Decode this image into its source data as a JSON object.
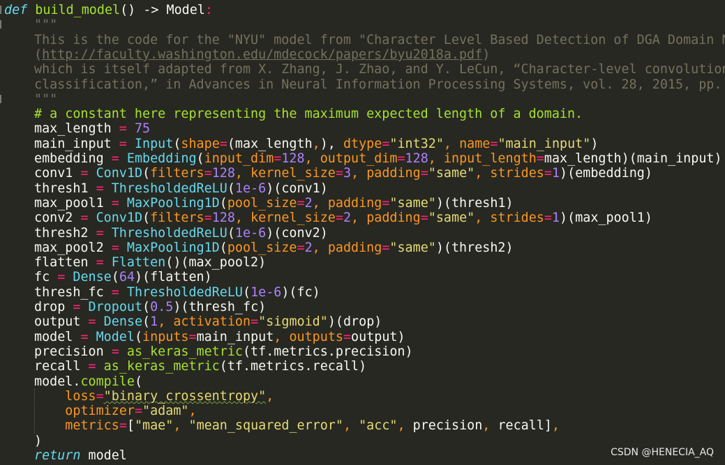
{
  "lines": [
    [
      [
        "kw",
        "def"
      ],
      [
        "plain",
        " "
      ],
      [
        "fn",
        "build_model"
      ],
      [
        "plain",
        "() -> Model"
      ],
      [
        "col",
        ":"
      ]
    ],
    [
      [
        "doc",
        "\"\"\""
      ]
    ],
    [
      [
        "doc",
        "This is the code for the \"NYU\" model from \"Character Level Based Detection of DGA Domain N"
      ]
    ],
    [
      [
        "doc",
        "("
      ],
      [
        "link",
        "http://faculty.washington.edu/mdecock/papers/byu2018a.pdf"
      ],
      [
        "doc",
        ")"
      ]
    ],
    [
      [
        "doc",
        "which is itself adapted from X. Zhang, J. Zhao, and Y. LeCun, “Character-level convolution"
      ]
    ],
    [
      [
        "doc",
        "classification,” in Advances in Neural Information Processing Systems, vol. 28, 2015, pp."
      ]
    ],
    [
      [
        "doc",
        "\"\"\""
      ]
    ],
    [
      [
        "cmt",
        "# a constant here representing the maximum expected length of a domain."
      ]
    ],
    [
      [
        "plain",
        "max_length "
      ],
      [
        "op",
        "="
      ],
      [
        "plain",
        " "
      ],
      [
        "num",
        "75"
      ]
    ],
    [
      [
        "plain",
        "main_input "
      ],
      [
        "op",
        "="
      ],
      [
        "plain",
        " "
      ],
      [
        "cls",
        "Input"
      ],
      [
        "plain",
        "("
      ],
      [
        "prm",
        "shape"
      ],
      [
        "op",
        "="
      ],
      [
        "plain",
        "(max_length"
      ],
      [
        "prm",
        ","
      ],
      [
        "plain",
        "), "
      ],
      [
        "prm",
        "dtype"
      ],
      [
        "op",
        "="
      ],
      [
        "str",
        "\"int32\""
      ],
      [
        "prm",
        ", "
      ],
      [
        "prm",
        "name"
      ],
      [
        "op",
        "="
      ],
      [
        "str",
        "\"main_input\""
      ],
      [
        "plain",
        ")"
      ]
    ],
    [
      [
        "plain",
        "embedding "
      ],
      [
        "op",
        "="
      ],
      [
        "plain",
        " "
      ],
      [
        "cls",
        "Embedding"
      ],
      [
        "plain",
        "("
      ],
      [
        "prm",
        "input_dim"
      ],
      [
        "op",
        "="
      ],
      [
        "num",
        "128"
      ],
      [
        "prm",
        ", "
      ],
      [
        "prm",
        "output_dim"
      ],
      [
        "op",
        "="
      ],
      [
        "num",
        "128"
      ],
      [
        "prm",
        ", "
      ],
      [
        "prm",
        "input_length"
      ],
      [
        "op",
        "="
      ],
      [
        "plain",
        "max_length)(main_input)"
      ]
    ],
    [
      [
        "plain",
        "conv1 "
      ],
      [
        "op",
        "="
      ],
      [
        "plain",
        " "
      ],
      [
        "cls",
        "Conv1D"
      ],
      [
        "plain",
        "("
      ],
      [
        "prm",
        "filters"
      ],
      [
        "op",
        "="
      ],
      [
        "num",
        "128"
      ],
      [
        "prm",
        ", "
      ],
      [
        "prm",
        "kernel_size"
      ],
      [
        "op",
        "="
      ],
      [
        "num",
        "3"
      ],
      [
        "prm",
        ", "
      ],
      [
        "prm",
        "padding"
      ],
      [
        "op",
        "="
      ],
      [
        "str",
        "\"same\""
      ],
      [
        "prm",
        ", "
      ],
      [
        "prm",
        "strides"
      ],
      [
        "op",
        "="
      ],
      [
        "num",
        "1"
      ],
      [
        "plain",
        ")(embedding)"
      ]
    ],
    [
      [
        "plain",
        "thresh1 "
      ],
      [
        "op",
        "="
      ],
      [
        "plain",
        " "
      ],
      [
        "cls",
        "ThresholdedReLU"
      ],
      [
        "plain",
        "("
      ],
      [
        "num",
        "1e-6"
      ],
      [
        "plain",
        ")(conv1)"
      ]
    ],
    [
      [
        "plain",
        "max_pool1 "
      ],
      [
        "op",
        "="
      ],
      [
        "plain",
        " "
      ],
      [
        "cls",
        "MaxPooling1D"
      ],
      [
        "plain",
        "("
      ],
      [
        "prm",
        "pool_size"
      ],
      [
        "op",
        "="
      ],
      [
        "num",
        "2"
      ],
      [
        "prm",
        ", "
      ],
      [
        "prm",
        "padding"
      ],
      [
        "op",
        "="
      ],
      [
        "str",
        "\"same\""
      ],
      [
        "plain",
        ")(thresh1)"
      ]
    ],
    [
      [
        "plain",
        "conv2 "
      ],
      [
        "op",
        "="
      ],
      [
        "plain",
        " "
      ],
      [
        "cls",
        "Conv1D"
      ],
      [
        "plain",
        "("
      ],
      [
        "prm",
        "filters"
      ],
      [
        "op",
        "="
      ],
      [
        "num",
        "128"
      ],
      [
        "prm",
        ", "
      ],
      [
        "prm",
        "kernel_size"
      ],
      [
        "op",
        "="
      ],
      [
        "num",
        "2"
      ],
      [
        "prm",
        ", "
      ],
      [
        "prm",
        "padding"
      ],
      [
        "op",
        "="
      ],
      [
        "str",
        "\"same\""
      ],
      [
        "prm",
        ", "
      ],
      [
        "prm",
        "strides"
      ],
      [
        "op",
        "="
      ],
      [
        "num",
        "1"
      ],
      [
        "plain",
        ")(max_pool1)"
      ]
    ],
    [
      [
        "plain",
        "thresh2 "
      ],
      [
        "op",
        "="
      ],
      [
        "plain",
        " "
      ],
      [
        "cls",
        "ThresholdedReLU"
      ],
      [
        "plain",
        "("
      ],
      [
        "num",
        "1e-6"
      ],
      [
        "plain",
        ")(conv2)"
      ]
    ],
    [
      [
        "plain",
        "max_pool2 "
      ],
      [
        "op",
        "="
      ],
      [
        "plain",
        " "
      ],
      [
        "cls",
        "MaxPooling1D"
      ],
      [
        "plain",
        "("
      ],
      [
        "prm",
        "pool_size"
      ],
      [
        "op",
        "="
      ],
      [
        "num",
        "2"
      ],
      [
        "prm",
        ", "
      ],
      [
        "prm",
        "padding"
      ],
      [
        "op",
        "="
      ],
      [
        "str",
        "\"same\""
      ],
      [
        "plain",
        ")(thresh2)"
      ]
    ],
    [
      [
        "plain",
        "flatten "
      ],
      [
        "op",
        "="
      ],
      [
        "plain",
        " "
      ],
      [
        "cls",
        "Flatten"
      ],
      [
        "plain",
        "()(max_pool2)"
      ]
    ],
    [
      [
        "plain",
        "fc "
      ],
      [
        "op",
        "="
      ],
      [
        "plain",
        " "
      ],
      [
        "cls",
        "Dense"
      ],
      [
        "plain",
        "("
      ],
      [
        "num",
        "64"
      ],
      [
        "plain",
        ")(flatten)"
      ]
    ],
    [
      [
        "plain",
        "thresh_fc "
      ],
      [
        "op",
        "="
      ],
      [
        "plain",
        " "
      ],
      [
        "cls",
        "ThresholdedReLU"
      ],
      [
        "plain",
        "("
      ],
      [
        "num",
        "1e-6"
      ],
      [
        "plain",
        ")(fc)"
      ]
    ],
    [
      [
        "plain",
        "drop "
      ],
      [
        "op",
        "="
      ],
      [
        "plain",
        " "
      ],
      [
        "cls",
        "Dropout"
      ],
      [
        "plain",
        "("
      ],
      [
        "num",
        "0.5"
      ],
      [
        "plain",
        ")(thresh_fc)"
      ]
    ],
    [
      [
        "plain",
        "output "
      ],
      [
        "op",
        "="
      ],
      [
        "plain",
        " "
      ],
      [
        "cls",
        "Dense"
      ],
      [
        "plain",
        "("
      ],
      [
        "num",
        "1"
      ],
      [
        "prm",
        ", "
      ],
      [
        "prm",
        "activation"
      ],
      [
        "op",
        "="
      ],
      [
        "str",
        "\"sigmoid\""
      ],
      [
        "plain",
        ")(drop)"
      ]
    ],
    [
      [
        "plain",
        "model "
      ],
      [
        "op",
        "="
      ],
      [
        "plain",
        " "
      ],
      [
        "cls",
        "Model"
      ],
      [
        "plain",
        "("
      ],
      [
        "prm",
        "inputs"
      ],
      [
        "op",
        "="
      ],
      [
        "plain",
        "main_input"
      ],
      [
        "prm",
        ", "
      ],
      [
        "prm",
        "outputs"
      ],
      [
        "op",
        "="
      ],
      [
        "plain",
        "output)"
      ]
    ],
    [
      [
        "plain",
        "precision "
      ],
      [
        "op",
        "="
      ],
      [
        "plain",
        " "
      ],
      [
        "fn",
        "as_keras_metric"
      ],
      [
        "plain",
        "(tf.metrics.precision)"
      ]
    ],
    [
      [
        "plain",
        "recall "
      ],
      [
        "op",
        "="
      ],
      [
        "plain",
        " "
      ],
      [
        "fn",
        "as_keras_metric"
      ],
      [
        "plain",
        "(tf.metrics.recall)"
      ]
    ],
    [
      [
        "plain",
        "model."
      ],
      [
        "fn",
        "compile"
      ],
      [
        "plain",
        "("
      ]
    ],
    [
      [
        "plain",
        "    "
      ],
      [
        "prm",
        "loss"
      ],
      [
        "op",
        "="
      ],
      [
        "str",
        "\"binary_crossentropy\""
      ],
      [
        "prm",
        ","
      ]
    ],
    [
      [
        "plain",
        "    "
      ],
      [
        "prm",
        "optimizer"
      ],
      [
        "op",
        "="
      ],
      [
        "str",
        "\"adam\""
      ],
      [
        "prm",
        ","
      ]
    ],
    [
      [
        "plain",
        "    "
      ],
      [
        "prm",
        "metrics"
      ],
      [
        "op",
        "="
      ],
      [
        "plain",
        "["
      ],
      [
        "str",
        "\"mae\""
      ],
      [
        "prm",
        ", "
      ],
      [
        "str",
        "\"mean_squared_error\""
      ],
      [
        "prm",
        ", "
      ],
      [
        "str",
        "\"acc\""
      ],
      [
        "prm",
        ", "
      ],
      [
        "plain",
        "precision"
      ],
      [
        "prm",
        ", "
      ],
      [
        "plain",
        "recall]"
      ],
      [
        "prm",
        ","
      ]
    ],
    [
      [
        "plain",
        ")"
      ]
    ],
    [
      [
        "kw",
        "return"
      ],
      [
        "plain",
        " model"
      ]
    ]
  ],
  "watermark": "CSDN @HENECIA_AQ"
}
